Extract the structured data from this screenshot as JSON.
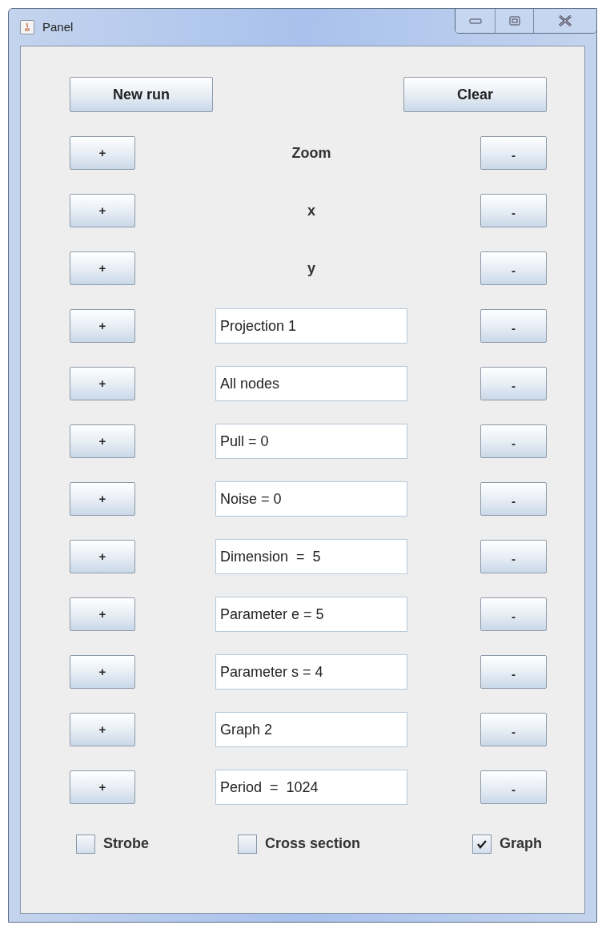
{
  "window": {
    "title": "Panel"
  },
  "top_buttons": [
    "New run",
    "Clear"
  ],
  "rows": [
    {
      "kind": "label",
      "text": "Zoom",
      "plus": "+",
      "minus": "-"
    },
    {
      "kind": "label",
      "text": "x",
      "plus": "+",
      "minus": "-"
    },
    {
      "kind": "label",
      "text": "y",
      "plus": "+",
      "minus": "-"
    },
    {
      "kind": "field",
      "text": "Projection 1",
      "plus": "+",
      "minus": "-"
    },
    {
      "kind": "field",
      "text": "All nodes",
      "plus": "+",
      "minus": "-"
    },
    {
      "kind": "field",
      "text": "Pull = 0",
      "plus": "+",
      "minus": "-"
    },
    {
      "kind": "field",
      "text": "Noise = 0",
      "plus": "+",
      "minus": "-"
    },
    {
      "kind": "field",
      "text": "Dimension  =  5",
      "plus": "+",
      "minus": "-"
    },
    {
      "kind": "field",
      "text": "Parameter e = 5",
      "plus": "+",
      "minus": "-"
    },
    {
      "kind": "field",
      "text": "Parameter s = 4",
      "plus": "+",
      "minus": "-"
    },
    {
      "kind": "field",
      "text": "Graph 2",
      "plus": "+",
      "minus": "-"
    },
    {
      "kind": "field",
      "text": "Period  =  1024",
      "plus": "+",
      "minus": "-"
    }
  ],
  "checkboxes": [
    {
      "label": "Strobe",
      "checked": false
    },
    {
      "label": "Cross section",
      "checked": false
    },
    {
      "label": "Graph",
      "checked": true
    }
  ]
}
